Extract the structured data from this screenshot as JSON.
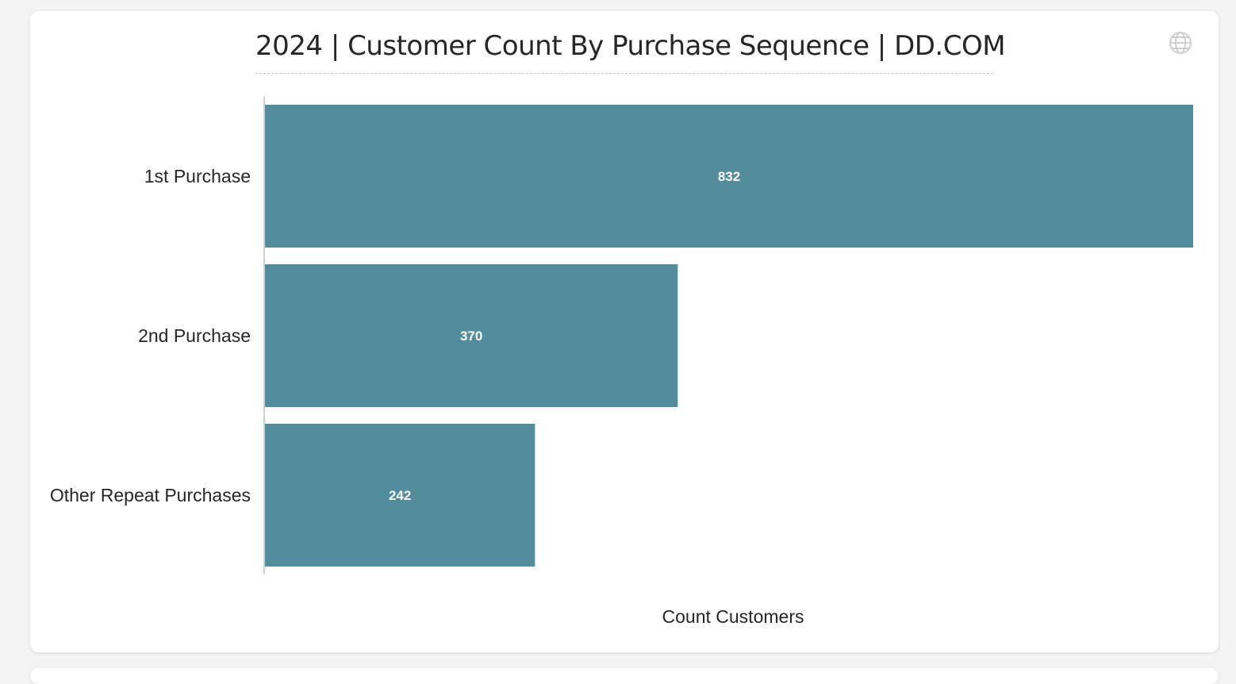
{
  "chart": {
    "title": "2024 | Customer Count By Purchase Sequence | DD.COM",
    "icon": "globe-icon"
  },
  "colors": {
    "bar": "#538c9a",
    "axis": "#d0d0d0",
    "label_on_bar": "#ffffff"
  },
  "chart_data": {
    "type": "bar",
    "orientation": "horizontal",
    "title": "2024 | Customer Count By Purchase Sequence | DD.COM",
    "xlabel": "Count Customers",
    "ylabel": "",
    "categories": [
      "1st Purchase",
      "2nd Purchase",
      "Other Repeat Purchases"
    ],
    "values": [
      832,
      370,
      242
    ],
    "xlim": [
      0,
      832
    ],
    "grid": false,
    "legend": "none",
    "data_labels": [
      "832",
      "370",
      "242"
    ]
  }
}
